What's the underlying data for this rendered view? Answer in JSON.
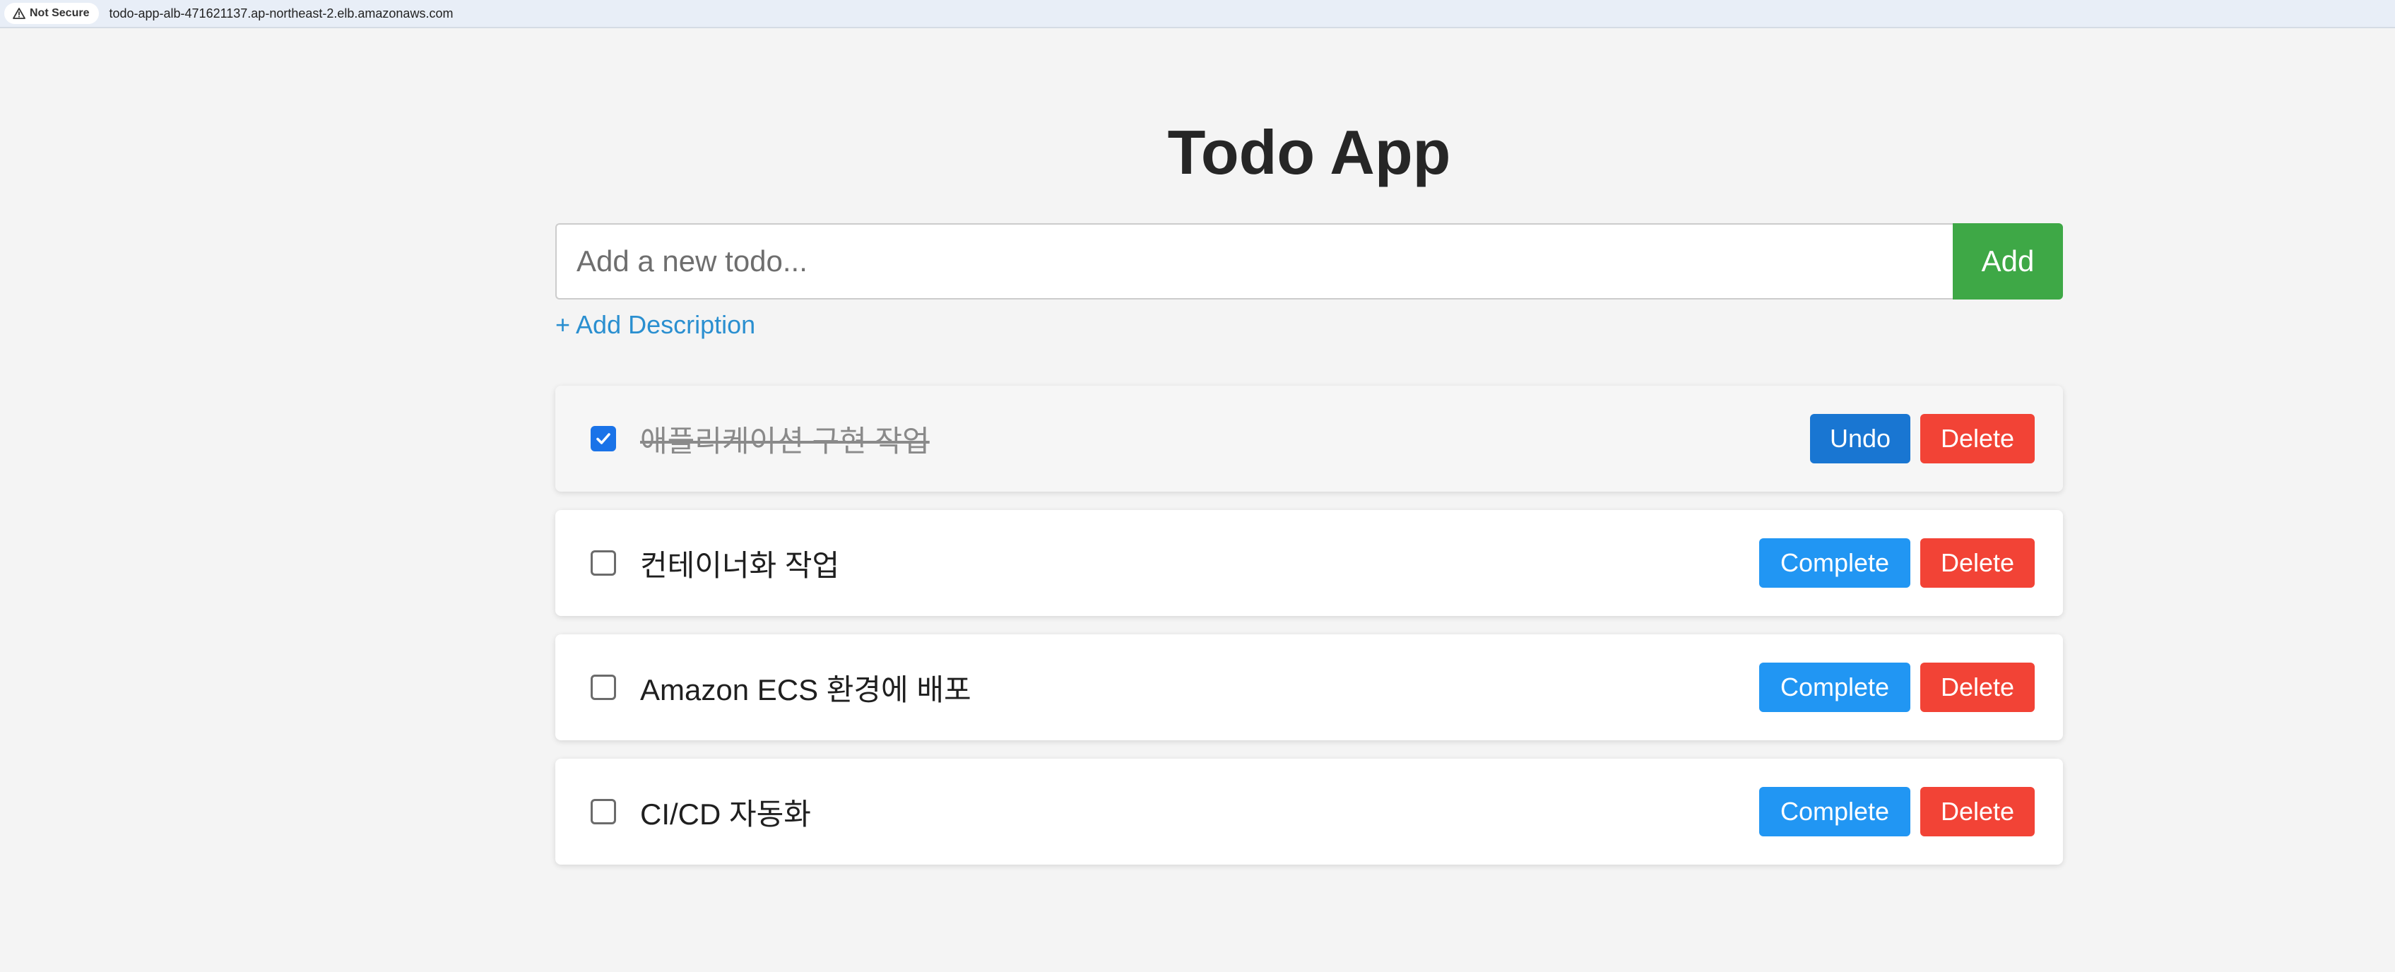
{
  "browser": {
    "security_label": "Not Secure",
    "url": "todo-app-alb-471621137.ap-northeast-2.elb.amazonaws.com"
  },
  "app": {
    "title": "Todo App",
    "input_placeholder": "Add a new todo...",
    "add_label": "Add",
    "add_description_label": "+ Add Description"
  },
  "todos": [
    {
      "text": "애플리케이션 구현 작업",
      "completed": true,
      "toggle_label": "Undo",
      "delete_label": "Delete"
    },
    {
      "text": "컨테이너화 작업",
      "completed": false,
      "toggle_label": "Complete",
      "delete_label": "Delete"
    },
    {
      "text": "Amazon ECS 환경에 배포",
      "completed": false,
      "toggle_label": "Complete",
      "delete_label": "Delete"
    },
    {
      "text": "CI/CD 자동화",
      "completed": false,
      "toggle_label": "Complete",
      "delete_label": "Delete"
    }
  ],
  "colors": {
    "add": "#3ea846",
    "complete": "#2196f3",
    "undo": "#1976d2",
    "delete": "#f24336",
    "link": "#2a8fd0"
  }
}
